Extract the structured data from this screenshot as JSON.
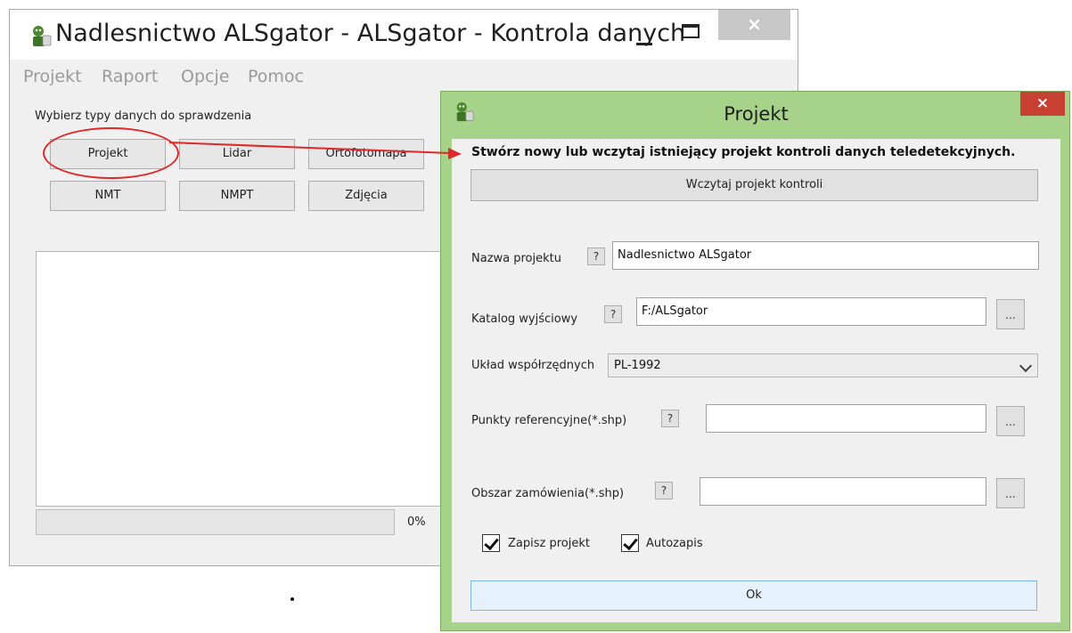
{
  "main_window": {
    "title": "Nadlesnictwo ALSgator - ALSgator - Kontrola danych",
    "close_glyph": "×",
    "menu": [
      "Projekt",
      "Raport",
      "Opcje",
      "Pomoc"
    ],
    "section_label": "Wybierz typy danych do sprawdzenia",
    "type_buttons": [
      "Projekt",
      "Lidar",
      "Ortofotomapa",
      "NMT",
      "NMPT",
      "Zdjęcia"
    ],
    "progress_value": 0,
    "progress_text": "0%",
    "icons": {
      "app": "alsgator-app-icon"
    }
  },
  "dialog": {
    "title": "Projekt",
    "close_glyph": "×",
    "heading": "Stwórz nowy lub wczytaj istniejący projekt kontroli danych teledetekcyjnych.",
    "load_button": "Wczytaj projekt kontroli",
    "help_glyph": "?",
    "browse_glyph": "...",
    "project_name": {
      "label": "Nazwa projektu",
      "value": "Nadlesnictwo ALSgator"
    },
    "output_dir": {
      "label": "Katalog wyjściowy",
      "value": "F:/ALSgator"
    },
    "coord_system": {
      "label": "Układ współrzędnych",
      "value": "PL-1992"
    },
    "reference_points": {
      "label": "Punkty referencyjne(*.shp)",
      "value": ""
    },
    "order_area": {
      "label": "Obszar zamówienia(*.shp)",
      "value": ""
    },
    "save_project": {
      "label": "Zapisz projekt",
      "checked": true
    },
    "autosave": {
      "label": "Autozapis",
      "checked": true
    },
    "ok_button": "Ok"
  },
  "colors": {
    "dialog_accent": "#a6d389",
    "dialog_close": "#c84031",
    "annotation": "#e02828",
    "ok_border": "#7eb4ea"
  }
}
